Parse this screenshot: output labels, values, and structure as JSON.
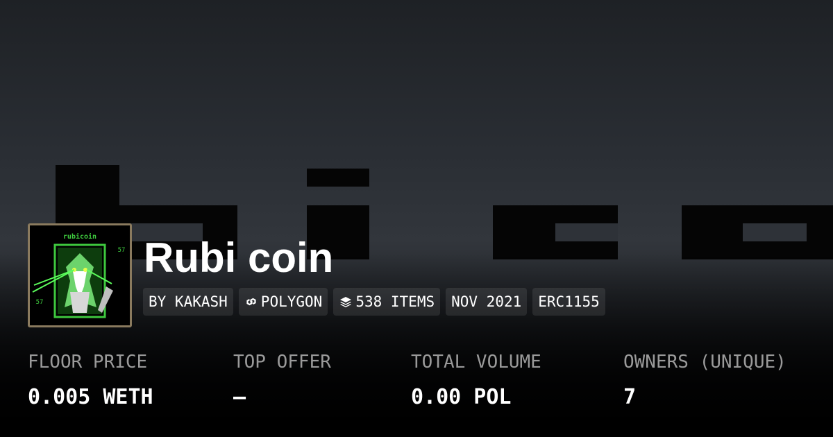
{
  "collection": {
    "title": "Rubi coin",
    "avatar_caption": "rubicoin",
    "avatar_number_top": "57",
    "avatar_number_bottom": "57",
    "banner_text": "bi co"
  },
  "chips": [
    {
      "label": "BY KAKASH",
      "icon": null
    },
    {
      "label": "POLYGON",
      "icon": "polygon-link-icon"
    },
    {
      "label": "538 ITEMS",
      "icon": "layers-icon"
    },
    {
      "label": "NOV 2021",
      "icon": null
    },
    {
      "label": "ERC1155",
      "icon": null
    }
  ],
  "stats": [
    {
      "label": "FLOOR PRICE",
      "value": "0.005 WETH"
    },
    {
      "label": "TOP OFFER",
      "value": "–"
    },
    {
      "label": "TOTAL VOLUME",
      "value": "0.00 POL"
    },
    {
      "label": "OWNERS (UNIQUE)",
      "value": "7"
    }
  ],
  "colors": {
    "avatar_green": "#3ec93e",
    "avatar_border": "#8a7a5e",
    "muted_text": "#9a9a9a",
    "chip_bg": "rgba(255,255,255,0.09)"
  }
}
